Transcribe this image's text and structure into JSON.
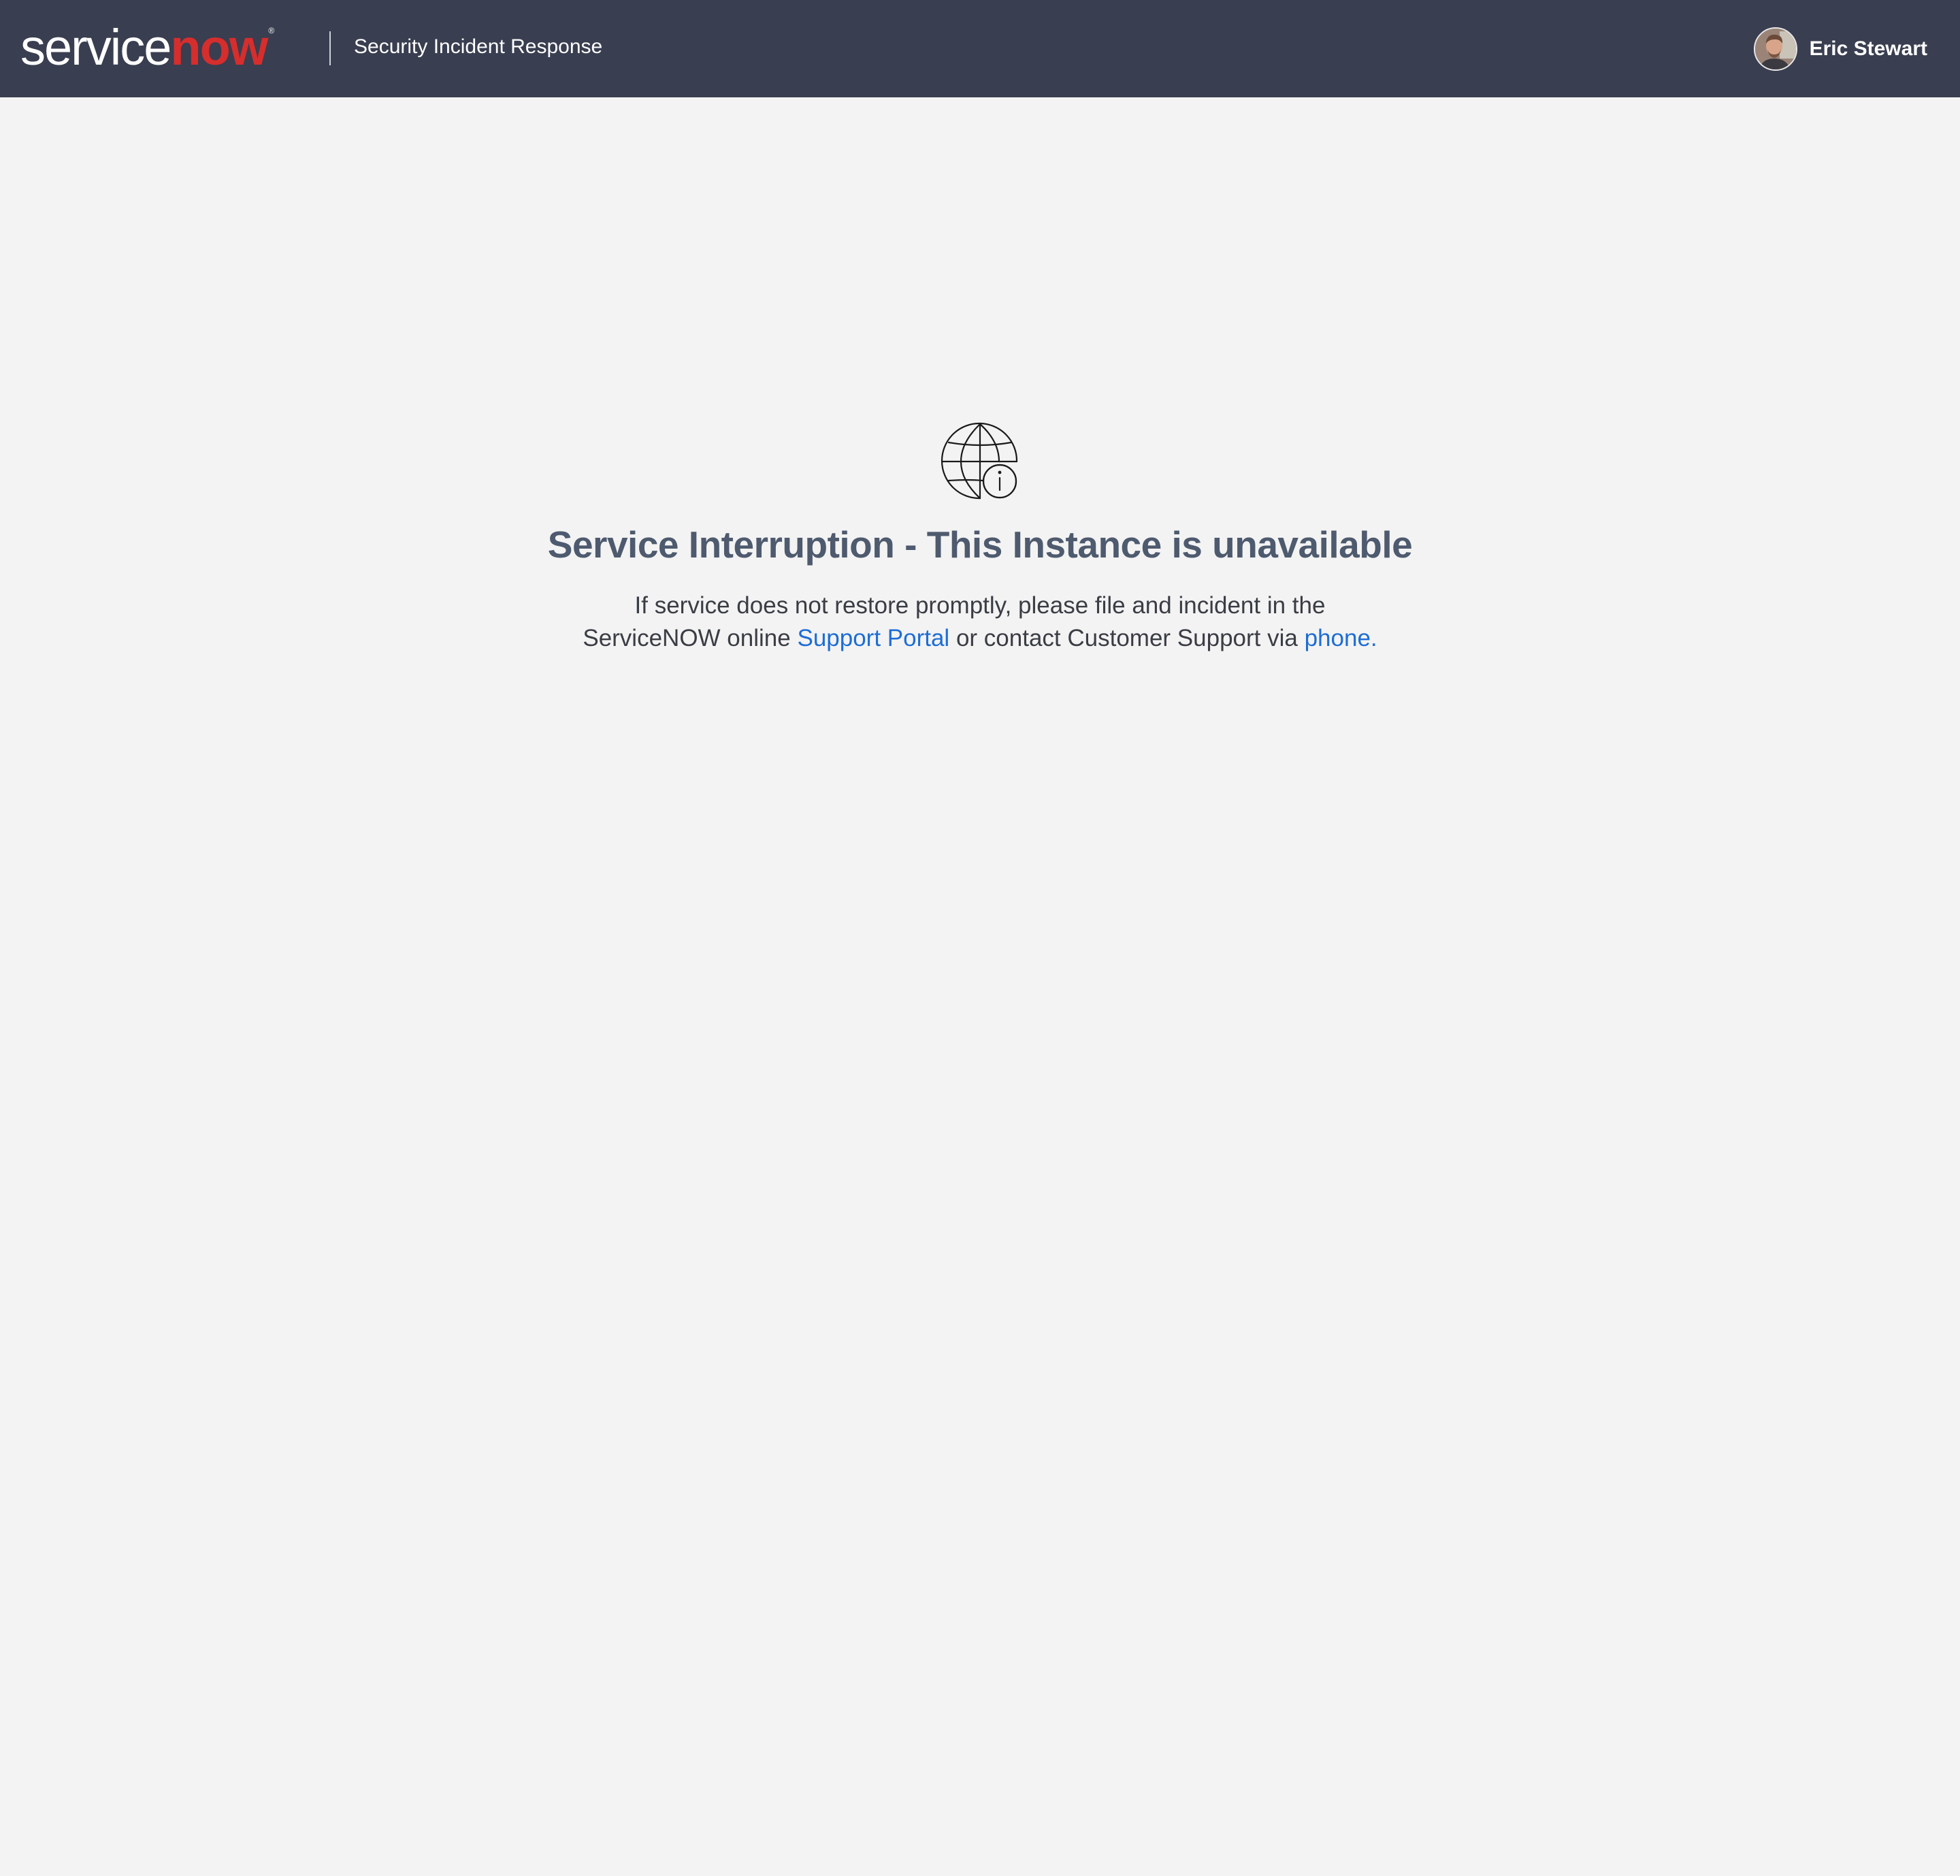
{
  "header": {
    "logo": {
      "service": "service",
      "now": "now",
      "tm": "®"
    },
    "app_name": "Security Incident Response",
    "user": {
      "name": "Eric Stewart"
    }
  },
  "main": {
    "icon": "globe-info-icon",
    "title": "Service Interruption - This Instance is unavailable",
    "message": {
      "line1": "If service does not restore promptly, please file and incident in the",
      "line2_prefix": "ServiceNOW online",
      "support_portal_link": "Support Portal",
      "line2_middle": "or contact Customer Support via",
      "phone_link": "phone."
    }
  },
  "colors": {
    "header_bg": "#393e50",
    "page_bg": "#f3f3f3",
    "brand_red": "#d62d2d",
    "title": "#4e5a6e",
    "link": "#1d6dd6"
  }
}
